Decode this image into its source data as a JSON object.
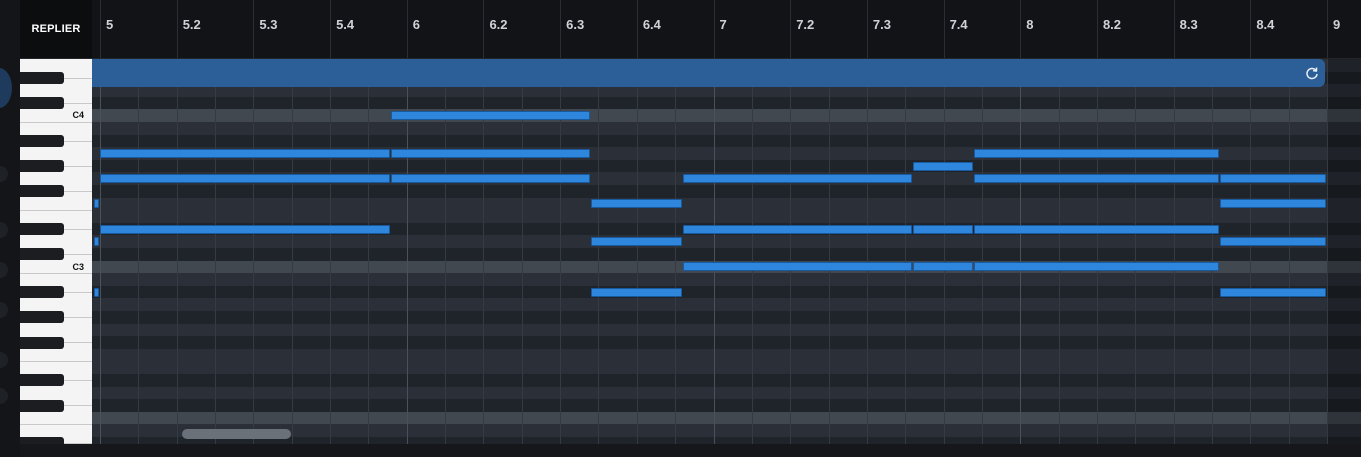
{
  "app": {
    "logo_text": "REPLIER"
  },
  "timeline": {
    "ticks": [
      {
        "label": "5",
        "bar": true
      },
      {
        "label": "5.2",
        "bar": false
      },
      {
        "label": "5.3",
        "bar": false
      },
      {
        "label": "5.4",
        "bar": false
      },
      {
        "label": "6",
        "bar": true
      },
      {
        "label": "6.2",
        "bar": false
      },
      {
        "label": "6.3",
        "bar": false
      },
      {
        "label": "6.4",
        "bar": false
      },
      {
        "label": "7",
        "bar": true
      },
      {
        "label": "7.2",
        "bar": false
      },
      {
        "label": "7.3",
        "bar": false
      },
      {
        "label": "7.4",
        "bar": false
      },
      {
        "label": "8",
        "bar": true
      },
      {
        "label": "8.2",
        "bar": false
      },
      {
        "label": "8.3",
        "bar": false
      },
      {
        "label": "8.4",
        "bar": false
      },
      {
        "label": "9",
        "bar": true
      }
    ]
  },
  "keyboard": {
    "labels": [
      "C4",
      "C3"
    ]
  },
  "loop_region": {
    "icon": "loop-icon",
    "color": "#2c5f98"
  },
  "notes": [
    {
      "pitch": "C4",
      "start": 5.95,
      "end": 6.6
    },
    {
      "pitch": "A3",
      "start": 5.0,
      "end": 5.95
    },
    {
      "pitch": "A3",
      "start": 5.95,
      "end": 6.6
    },
    {
      "pitch": "A3",
      "start": 7.85,
      "end": 8.65
    },
    {
      "pitch": "G#3",
      "start": 7.65,
      "end": 7.85
    },
    {
      "pitch": "G3",
      "start": 5.0,
      "end": 5.95
    },
    {
      "pitch": "G3",
      "start": 5.95,
      "end": 6.6
    },
    {
      "pitch": "G3",
      "start": 6.9,
      "end": 7.65
    },
    {
      "pitch": "G3",
      "start": 7.85,
      "end": 8.65
    },
    {
      "pitch": "G3",
      "start": 8.65,
      "end": 9.0
    },
    {
      "pitch": "F3",
      "start": 4.98,
      "end": 5.0
    },
    {
      "pitch": "F3",
      "start": 6.6,
      "end": 6.9
    },
    {
      "pitch": "F3",
      "start": 8.65,
      "end": 9.0
    },
    {
      "pitch": "D#3",
      "start": 5.0,
      "end": 5.95
    },
    {
      "pitch": "D#3",
      "start": 6.9,
      "end": 7.65
    },
    {
      "pitch": "D#3",
      "start": 7.65,
      "end": 7.85
    },
    {
      "pitch": "D#3",
      "start": 7.85,
      "end": 8.65
    },
    {
      "pitch": "D3",
      "start": 4.98,
      "end": 5.0
    },
    {
      "pitch": "D3",
      "start": 6.6,
      "end": 6.9
    },
    {
      "pitch": "D3",
      "start": 8.65,
      "end": 9.0
    },
    {
      "pitch": "C3",
      "start": 6.9,
      "end": 7.65
    },
    {
      "pitch": "C3",
      "start": 7.65,
      "end": 7.85
    },
    {
      "pitch": "C3",
      "start": 7.85,
      "end": 8.65
    },
    {
      "pitch": "A#2",
      "start": 4.98,
      "end": 5.0
    },
    {
      "pitch": "A#2",
      "start": 6.6,
      "end": 6.9
    },
    {
      "pitch": "A#2",
      "start": 8.65,
      "end": 9.0
    }
  ],
  "colors": {
    "note": "#2f86dd",
    "loop": "#2c5f98",
    "background": "#17191d"
  },
  "scrollbar": {
    "position": 0.1
  }
}
